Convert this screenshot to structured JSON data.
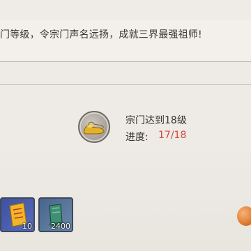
{
  "description": "门等级，令宗门声名远扬，成就三界最强祖师!",
  "quest": {
    "icon": "golden-shoes-icon",
    "title": "宗门达到18级",
    "progress_label": "进度:",
    "progress_value": "17/18"
  },
  "rewards": [
    {
      "icon": "scroll-ticket-icon",
      "count": "10"
    },
    {
      "icon": "jade-item-icon",
      "count": "2400"
    }
  ],
  "colors": {
    "progress": "#d24a3f",
    "text": "#333333"
  }
}
